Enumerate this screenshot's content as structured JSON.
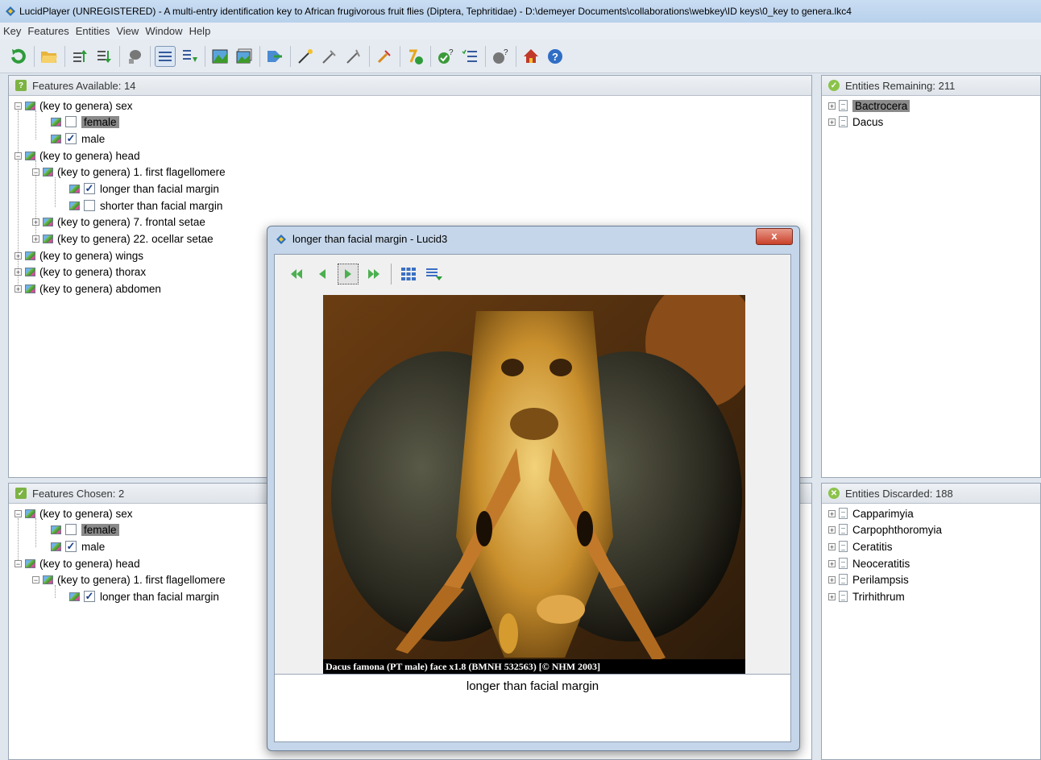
{
  "window": {
    "title": "LucidPlayer (UNREGISTERED) - A multi-entry identification key to African frugivorous fruit flies (Diptera, Tephritidae) - D:\\demeyer Documents\\collaborations\\webkey\\ID keys\\0_key to genera.lkc4"
  },
  "menu": [
    "Key",
    "Features",
    "Entities",
    "View",
    "Window",
    "Help"
  ],
  "toolbar_icons": [
    "restart-icon",
    "open-folder-icon",
    "promote-icon",
    "demote-icon",
    "best-icon",
    "list-view-icon",
    "tree-view-icon",
    "image-icon",
    "image-gallery-icon",
    "compare-icon",
    "wand-icon",
    "wand-alt-icon",
    "wand-alt2-icon",
    "pin-icon",
    "calc-icon",
    "check-question-icon",
    "checklist-icon",
    "question-icon",
    "home-icon",
    "help-icon"
  ],
  "features_available": {
    "header": "Features Available: 14",
    "rows": [
      {
        "label": "(key to genera) sex"
      },
      {
        "label": "female"
      },
      {
        "label": "male"
      },
      {
        "label": "(key to genera) head"
      },
      {
        "label": "(key to genera) 1. first flagellomere"
      },
      {
        "label": "longer than facial margin"
      },
      {
        "label": "shorter than facial margin"
      },
      {
        "label": "(key to genera) 7. frontal setae"
      },
      {
        "label": "(key to genera) 22. ocellar setae"
      },
      {
        "label": "(key to genera) wings"
      },
      {
        "label": "(key to genera) thorax"
      },
      {
        "label": "(key to genera) abdomen"
      }
    ]
  },
  "features_chosen": {
    "header": "Features Chosen: 2",
    "rows": [
      {
        "label": "(key to genera) sex"
      },
      {
        "label": "female"
      },
      {
        "label": "male"
      },
      {
        "label": "(key to genera) head"
      },
      {
        "label": "(key to genera) 1. first flagellomere"
      },
      {
        "label": "longer than facial margin"
      }
    ]
  },
  "entities_remaining": {
    "header": "Entities Remaining: 211",
    "items": [
      "Bactrocera",
      "Dacus"
    ]
  },
  "entities_discarded": {
    "header": "Entities Discarded: 188",
    "items": [
      "Capparimyia",
      "Carpophthoromyia",
      "Ceratitis",
      "Neoceratitis",
      "Perilampsis",
      "Trirhithrum"
    ]
  },
  "dialog": {
    "title": "longer than facial margin - Lucid3",
    "close": "x",
    "image_caption": "Dacus famona (PT male) face x1.8 (BMNH 532563) [© NHM 2003]",
    "description": "longer than facial margin"
  },
  "colors": {
    "accent": "#1b3f8a",
    "selection": "#8a8a8a"
  }
}
